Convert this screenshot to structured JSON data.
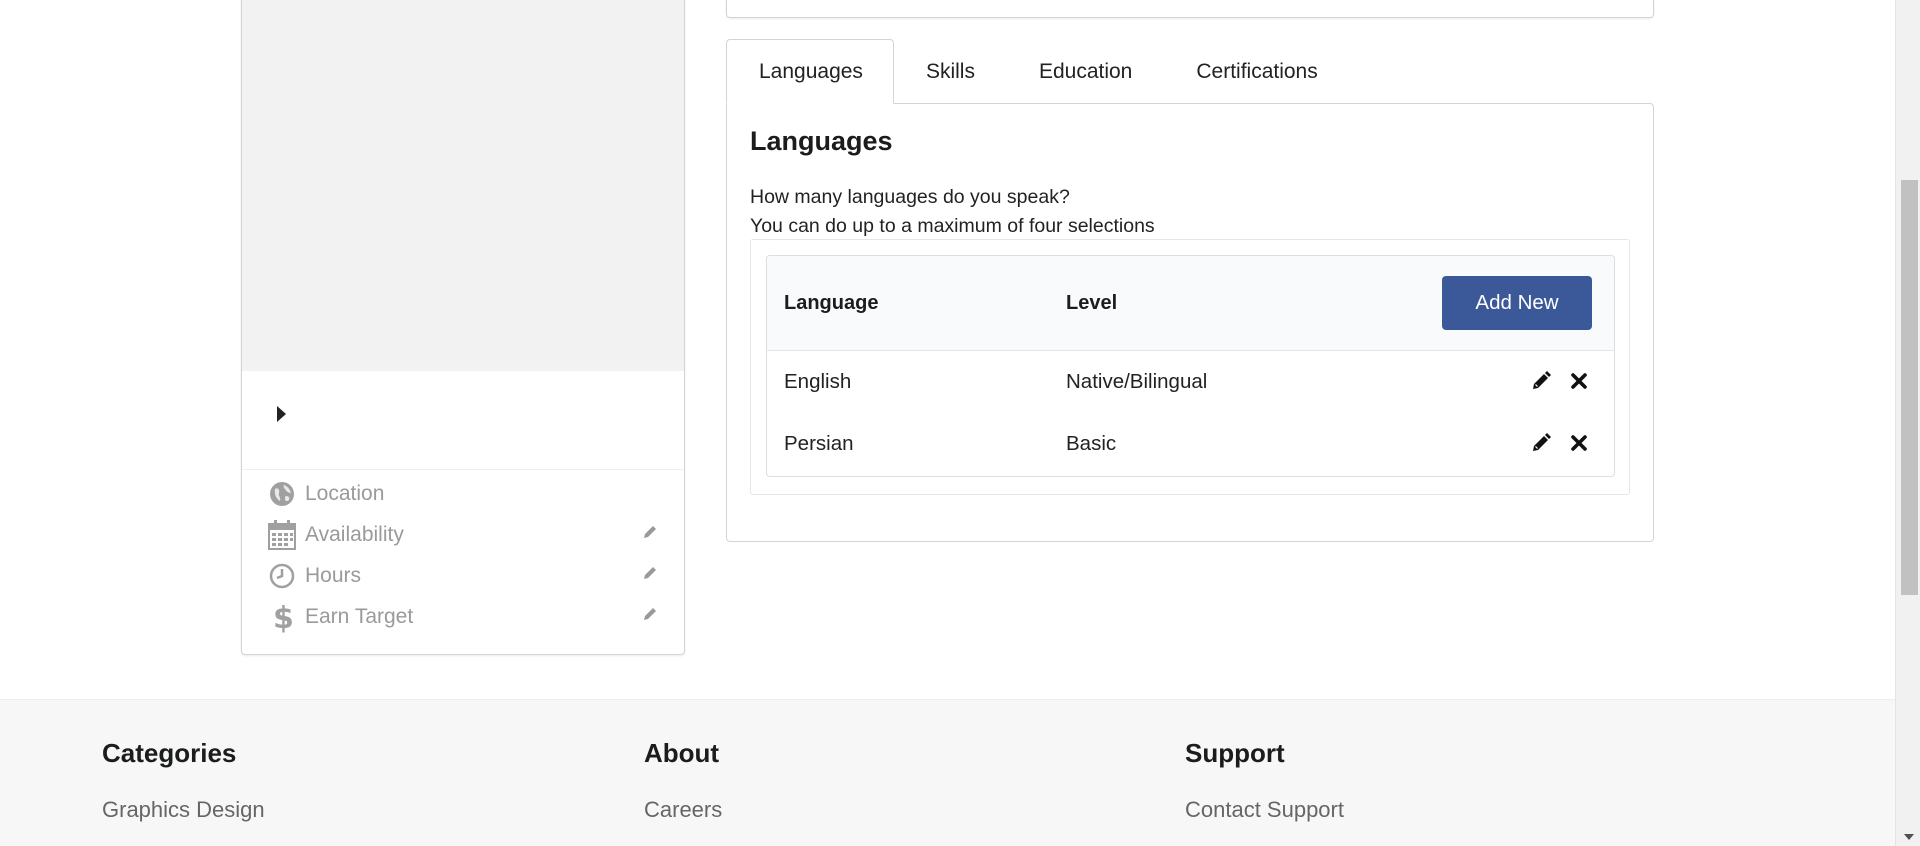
{
  "profile_card": {
    "meta": [
      {
        "icon": "globe-icon",
        "label": "Location",
        "editable": false
      },
      {
        "icon": "calendar-icon",
        "label": "Availability",
        "editable": true
      },
      {
        "icon": "clock-icon",
        "label": "Hours",
        "editable": true
      },
      {
        "icon": "dollar-icon",
        "label": "Earn Target",
        "editable": true
      }
    ]
  },
  "tabs": [
    {
      "label": "Languages",
      "active": true
    },
    {
      "label": "Skills",
      "active": false
    },
    {
      "label": "Education",
      "active": false
    },
    {
      "label": "Certifications",
      "active": false
    }
  ],
  "languages_panel": {
    "title": "Languages",
    "question": "How many languages do you speak?",
    "hint": "You can do up to a maximum of four selections",
    "columns": {
      "language": "Language",
      "level": "Level"
    },
    "add_button": "Add New",
    "rows": [
      {
        "language": "English",
        "level": "Native/Bilingual"
      },
      {
        "language": "Persian",
        "level": "Basic"
      }
    ]
  },
  "footer": {
    "columns": [
      {
        "heading": "Categories",
        "links": [
          "Graphics Design"
        ]
      },
      {
        "heading": "About",
        "links": [
          "Careers"
        ]
      },
      {
        "heading": "Support",
        "links": [
          "Contact Support"
        ]
      }
    ]
  },
  "colors": {
    "primary_button": "#3b5998",
    "muted_text": "#9a9a9a",
    "footer_bg": "#f7f7f7"
  }
}
